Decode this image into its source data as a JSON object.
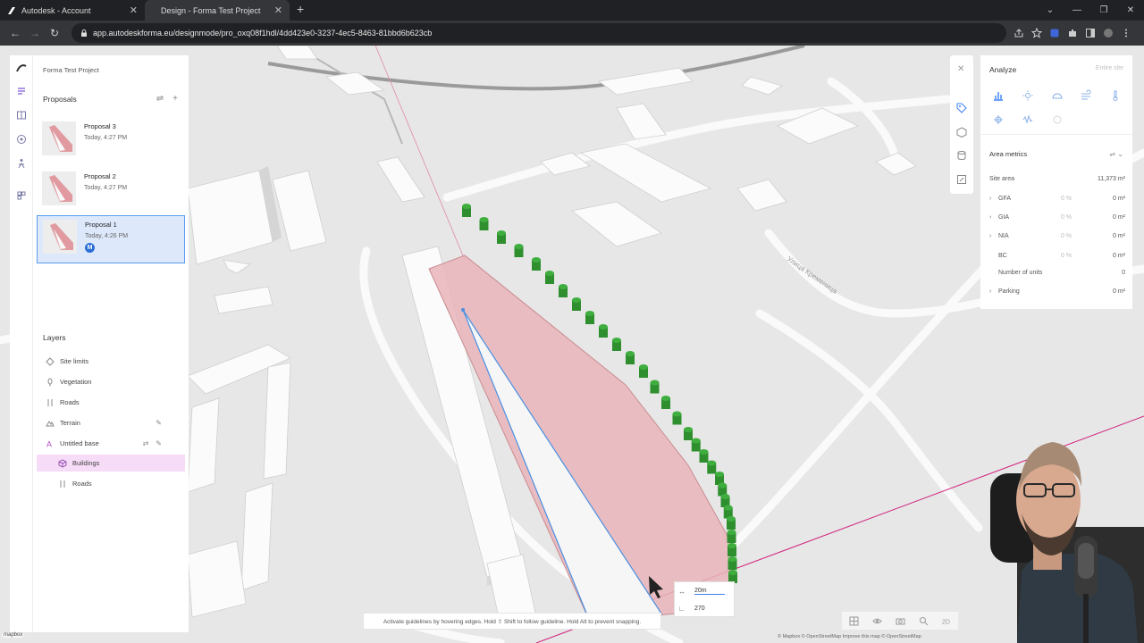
{
  "browser": {
    "tabs": [
      {
        "title": "Autodesk - Account",
        "active": false
      },
      {
        "title": "Design - Forma Test Project",
        "active": true
      }
    ],
    "new_tab": "+",
    "url": "app.autodeskforma.eu/designmode/pro_oxq08f1hdl/4dd423e0-3237-4ec5-8463-81bbd6b623cb"
  },
  "left_panel": {
    "project_name": "Forma Test Project",
    "proposals_title": "Proposals",
    "proposals": [
      {
        "name": "Proposal 3",
        "date": "Today, 4:27 PM",
        "selected": false
      },
      {
        "name": "Proposal 2",
        "date": "Today, 4:27 PM",
        "selected": false
      },
      {
        "name": "Proposal 1",
        "date": "Today, 4:26 PM",
        "selected": true,
        "badge": "M"
      }
    ],
    "layers_title": "Layers",
    "layers": [
      {
        "name": "Site limits",
        "icon": "site-limits-icon"
      },
      {
        "name": "Vegetation",
        "icon": "vegetation-icon"
      },
      {
        "name": "Roads",
        "icon": "roads-icon"
      },
      {
        "name": "Terrain",
        "icon": "terrain-icon"
      },
      {
        "name": "Untitled base",
        "icon": "base-icon"
      },
      {
        "name": "Buildings",
        "icon": "buildings-icon",
        "sub": true,
        "highlight": true
      },
      {
        "name": "Roads",
        "icon": "roads-icon",
        "sub": true
      }
    ]
  },
  "right_panel": {
    "title": "Analyze",
    "scope": "Entire site",
    "metrics_title": "Area metrics",
    "site_area_label": "Site area",
    "site_area_value": "11,373 m²",
    "metrics": [
      {
        "label": "GFA",
        "pct": "0 %",
        "value": "0 m²",
        "expandable": true
      },
      {
        "label": "GIA",
        "pct": "0 %",
        "value": "0 m²",
        "expandable": true
      },
      {
        "label": "NIA",
        "pct": "0 %",
        "value": "0 m²",
        "expandable": true
      },
      {
        "label": "BC",
        "pct": "0 %",
        "value": "0 m²",
        "expandable": false
      },
      {
        "label": "Number of units",
        "pct": "",
        "value": "0",
        "expandable": false
      },
      {
        "label": "Parking",
        "pct": "",
        "value": "0 m²",
        "expandable": true
      }
    ]
  },
  "canvas": {
    "hint": "Activate guidelines by hovering edges. Hold ⇧ Shift to follow guideline. Hold Alt to prevent snapping.",
    "dimension_length": "20m",
    "dimension_angle": "270",
    "street_label": "Улица Кременица",
    "credit": "© Mapbox © OpenStreetMap Improve this map © OpenStreetMap",
    "mapbox": "mapbox"
  },
  "colors": {
    "accent": "#2b6fd6",
    "site_fill": "#e8b4b8",
    "tree_green": "#3fae3f",
    "guide_magenta": "#d0207a",
    "layer_highlight": "#f6dcf6"
  }
}
